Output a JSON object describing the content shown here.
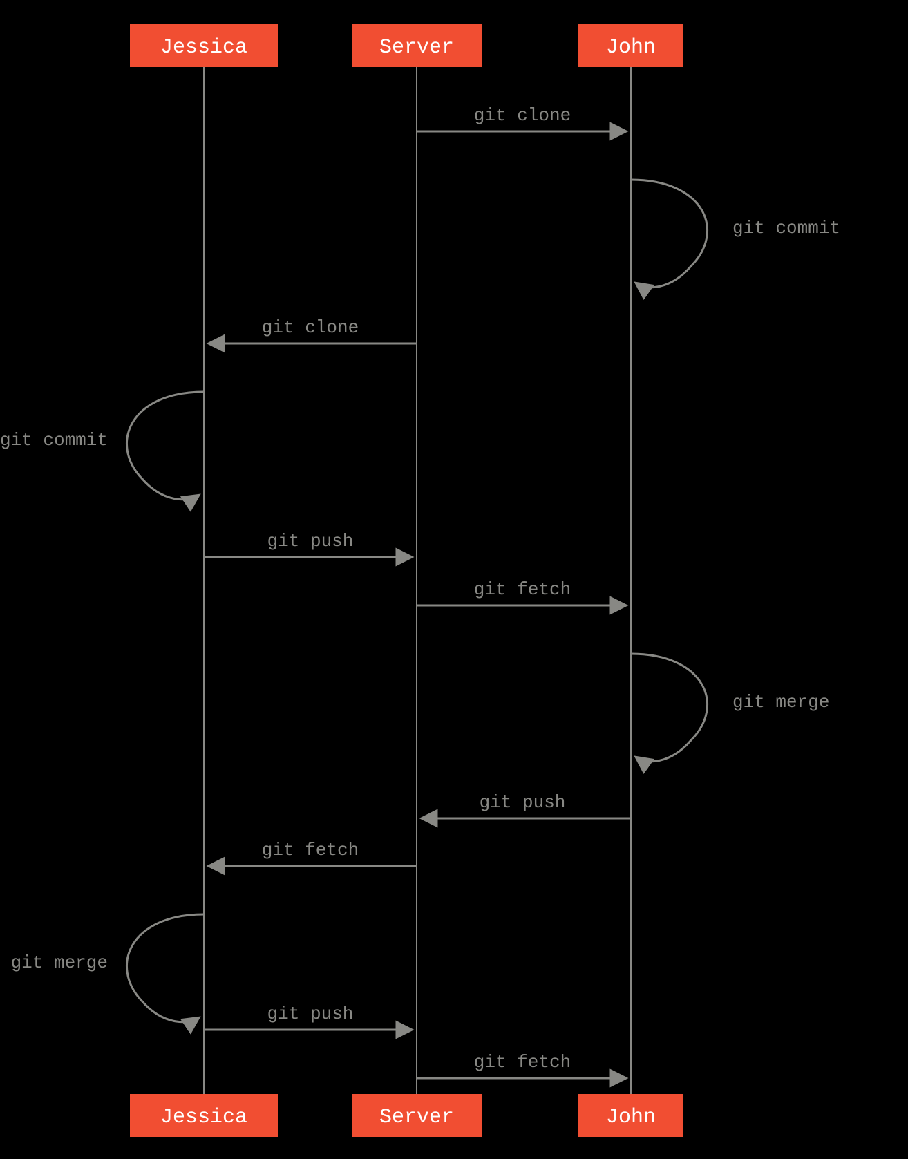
{
  "actors": {
    "jessica": "Jessica",
    "server": "Server",
    "john": "John"
  },
  "messages": {
    "m1": "git clone",
    "m2": "git commit",
    "m3": "git clone",
    "m4": "git commit",
    "m5": "git push",
    "m6": "git fetch",
    "m7": "git merge",
    "m8": "git push",
    "m9": "git fetch",
    "m10": "git merge",
    "m11": "git push",
    "m12": "git fetch"
  },
  "chart_data": {
    "type": "sequence",
    "actors": [
      "Jessica",
      "Server",
      "John"
    ],
    "events": [
      {
        "from": "Server",
        "to": "John",
        "label": "git clone"
      },
      {
        "from": "John",
        "to": "John",
        "label": "git commit"
      },
      {
        "from": "Server",
        "to": "Jessica",
        "label": "git clone"
      },
      {
        "from": "Jessica",
        "to": "Jessica",
        "label": "git commit"
      },
      {
        "from": "Jessica",
        "to": "Server",
        "label": "git push"
      },
      {
        "from": "Server",
        "to": "John",
        "label": "git fetch"
      },
      {
        "from": "John",
        "to": "John",
        "label": "git merge"
      },
      {
        "from": "John",
        "to": "Server",
        "label": "git push"
      },
      {
        "from": "Server",
        "to": "Jessica",
        "label": "git fetch"
      },
      {
        "from": "Jessica",
        "to": "Jessica",
        "label": "git merge"
      },
      {
        "from": "Jessica",
        "to": "Server",
        "label": "git push"
      },
      {
        "from": "Server",
        "to": "John",
        "label": "git fetch"
      }
    ]
  }
}
